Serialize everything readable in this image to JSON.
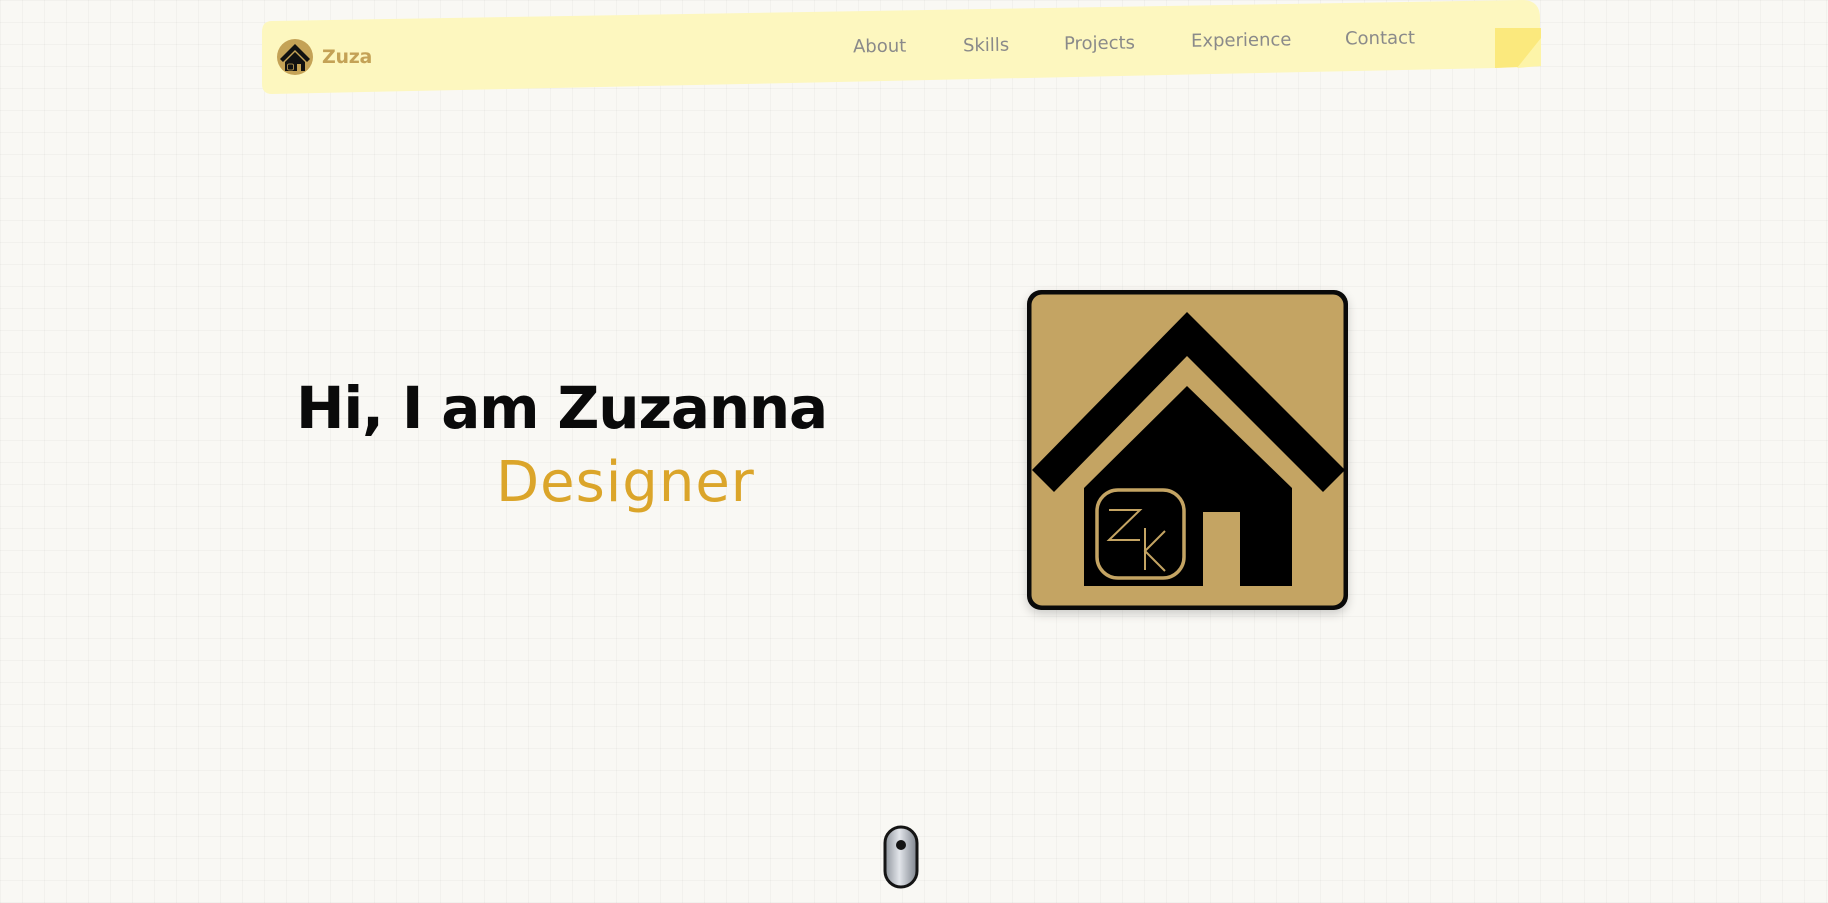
{
  "nav": {
    "brand_name": "Zuza",
    "links": [
      {
        "label": "About"
      },
      {
        "label": "Skills"
      },
      {
        "label": "Projects"
      },
      {
        "label": "Experience"
      },
      {
        "label": "Contact"
      }
    ]
  },
  "hero": {
    "title": "Hi, I am Zuzanna",
    "role": "Designer",
    "logo_monogram": "ZK"
  },
  "scroll_indicator": {
    "icon": "mouse-scroll-icon"
  },
  "colors": {
    "accent_gold": "#c4a256",
    "role_text": "#dba52a",
    "nav_note": "#fdf7bf",
    "nav_link": "#8a8a8a",
    "heading": "#0a0a0a",
    "background": "#f9f8f4"
  }
}
